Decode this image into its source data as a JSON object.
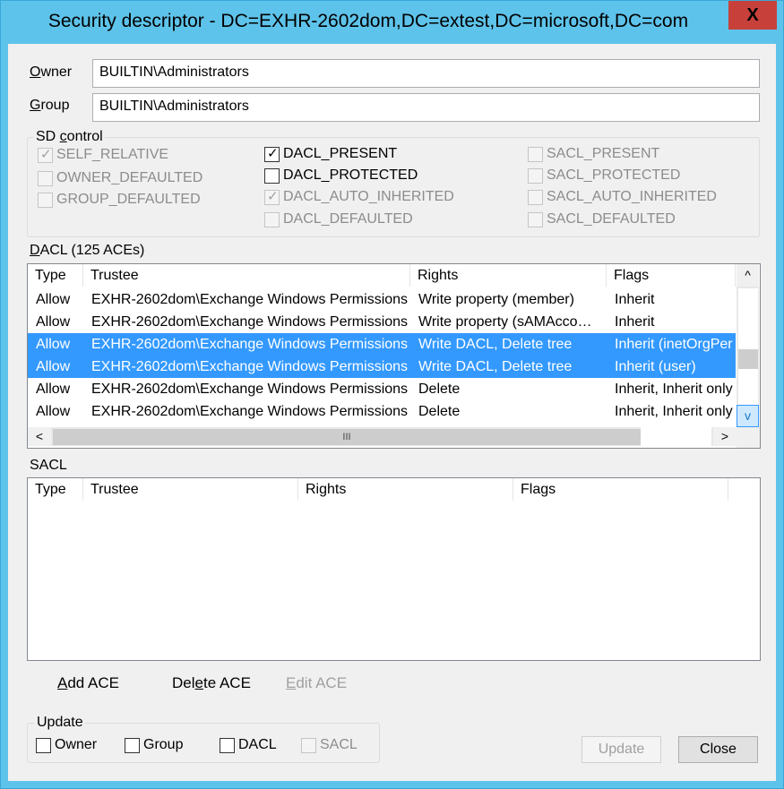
{
  "window": {
    "title": "Security descriptor - DC=EXHR-2602dom,DC=extest,DC=microsoft,DC=com",
    "close_glyph": "X"
  },
  "owner": {
    "label_first": "O",
    "label_rest": "wner",
    "value": "BUILTIN\\Administrators"
  },
  "group": {
    "label_first": "G",
    "label_rest": "roup",
    "value": "BUILTIN\\Administrators"
  },
  "sd_control": {
    "title_prefix": "SD ",
    "title_mnemonic": "c",
    "title_suffix": "ontrol",
    "flags": [
      {
        "label": "SELF_RELATIVE",
        "checked": true,
        "enabled": false
      },
      {
        "label": "OWNER_DEFAULTED",
        "checked": false,
        "enabled": false
      },
      {
        "label": "GROUP_DEFAULTED",
        "checked": false,
        "enabled": false
      },
      {
        "label": "DACL_PRESENT",
        "checked": true,
        "enabled": true
      },
      {
        "label": "DACL_PROTECTED",
        "checked": false,
        "enabled": true
      },
      {
        "label": "DACL_AUTO_INHERITED",
        "checked": true,
        "enabled": false
      },
      {
        "label": "DACL_DEFAULTED",
        "checked": false,
        "enabled": false
      },
      {
        "label": "SACL_PRESENT",
        "checked": false,
        "enabled": false
      },
      {
        "label": "SACL_PROTECTED",
        "checked": false,
        "enabled": false
      },
      {
        "label": "SACL_AUTO_INHERITED",
        "checked": false,
        "enabled": false
      },
      {
        "label": "SACL_DEFAULTED",
        "checked": false,
        "enabled": false
      }
    ]
  },
  "dacl": {
    "label_first": "D",
    "label_rest": "ACL (125 ACEs)",
    "columns": [
      "Type",
      "Trustee",
      "Rights",
      "Flags"
    ],
    "rows": [
      {
        "type": "Allow",
        "trustee": "EXHR-2602dom\\Exchange Windows Permissions",
        "rights": "Write property (member)",
        "flags": "Inherit",
        "selected": false
      },
      {
        "type": "Allow",
        "trustee": "EXHR-2602dom\\Exchange Windows Permissions",
        "rights": "Write property (sAMAcco…",
        "flags": "Inherit",
        "selected": false
      },
      {
        "type": "Allow",
        "trustee": "EXHR-2602dom\\Exchange Windows Permissions",
        "rights": "Write DACL, Delete tree",
        "flags": "Inherit (inetOrgPer",
        "selected": true
      },
      {
        "type": "Allow",
        "trustee": "EXHR-2602dom\\Exchange Windows Permissions",
        "rights": "Write DACL, Delete tree",
        "flags": "Inherit (user)",
        "selected": true
      },
      {
        "type": "Allow",
        "trustee": "EXHR-2602dom\\Exchange Windows Permissions",
        "rights": "Delete",
        "flags": "Inherit, Inherit only",
        "selected": false
      },
      {
        "type": "Allow",
        "trustee": "EXHR-2602dom\\Exchange Windows Permissions",
        "rights": "Delete",
        "flags": "Inherit, Inherit only",
        "selected": false
      }
    ],
    "scroll_up": "^",
    "scroll_down": "v",
    "scroll_left": "<",
    "scroll_right": ">",
    "thumb_grip": "III"
  },
  "sacl": {
    "label": "SACL",
    "columns": [
      "Type",
      "Trustee",
      "Rights",
      "Flags"
    ]
  },
  "actions": {
    "add_first": "A",
    "add_rest": "dd ACE",
    "delete_pre": "Del",
    "delete_mn": "e",
    "delete_post": "te ACE",
    "edit_first": "E",
    "edit_rest": "dit ACE"
  },
  "update_group": {
    "title": "Update",
    "options": [
      {
        "label": "Owner",
        "checked": false,
        "enabled": true
      },
      {
        "label": "Group",
        "checked": false,
        "enabled": true
      },
      {
        "label": "DACL",
        "checked": false,
        "enabled": true
      },
      {
        "label": "SACL",
        "checked": false,
        "enabled": false
      }
    ]
  },
  "buttons": {
    "update": "Update",
    "close": "Close"
  },
  "check_glyph": "✓"
}
